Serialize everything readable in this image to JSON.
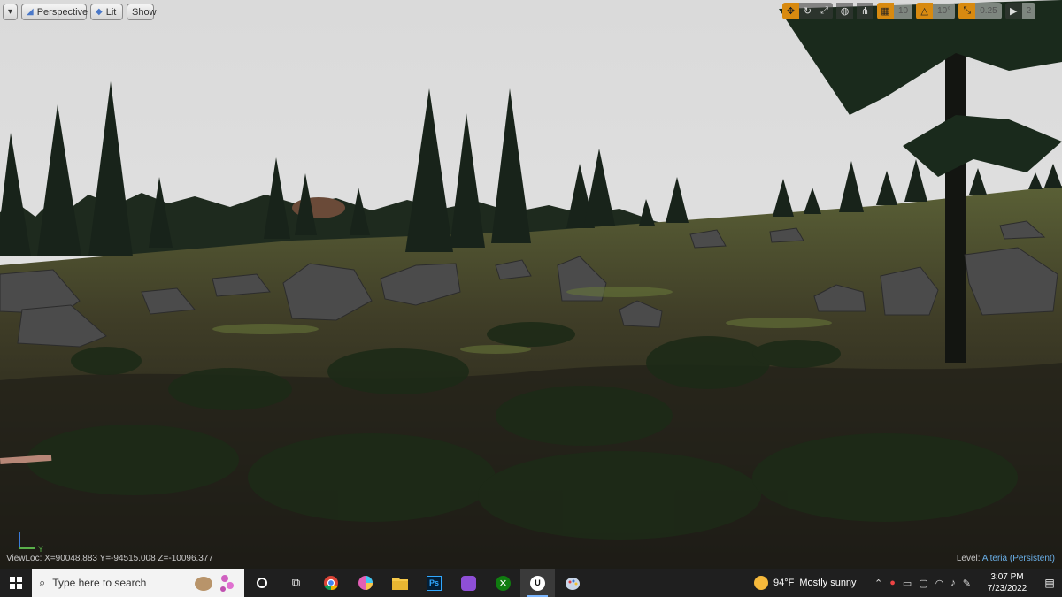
{
  "viewport_toolbar": {
    "menu_icon": "chevron-down-icon",
    "perspective_label": "Perspective",
    "lit_label": "Lit",
    "show_label": "Show",
    "grid_snap_value": "10",
    "rotation_snap_value": "10°",
    "scale_snap_value": "0.25",
    "camera_speed_value": "2"
  },
  "viewport": {
    "viewloc": "ViewLoc: X=90048.883 Y=-94515.008 Z=-10096.377",
    "level_label": "Level:",
    "level_name": "Alteria (Persistent)",
    "axis_y_label": "Y"
  },
  "taskbar": {
    "search_placeholder": "Type here to search",
    "apps": [
      "cortana",
      "task-view",
      "chrome",
      "color-app",
      "file-explorer",
      "photoshop",
      "app-purple",
      "xbox",
      "unreal-engine",
      "paint-app"
    ],
    "weather_temp": "94°F",
    "weather_desc": "Mostly sunny",
    "time": "3:07 PM",
    "date": "7/23/2022"
  },
  "colors": {
    "accent_orange": "#d88a10",
    "level_blue": "#6ab0e8",
    "taskbar_bg": "#1f1f1f"
  }
}
